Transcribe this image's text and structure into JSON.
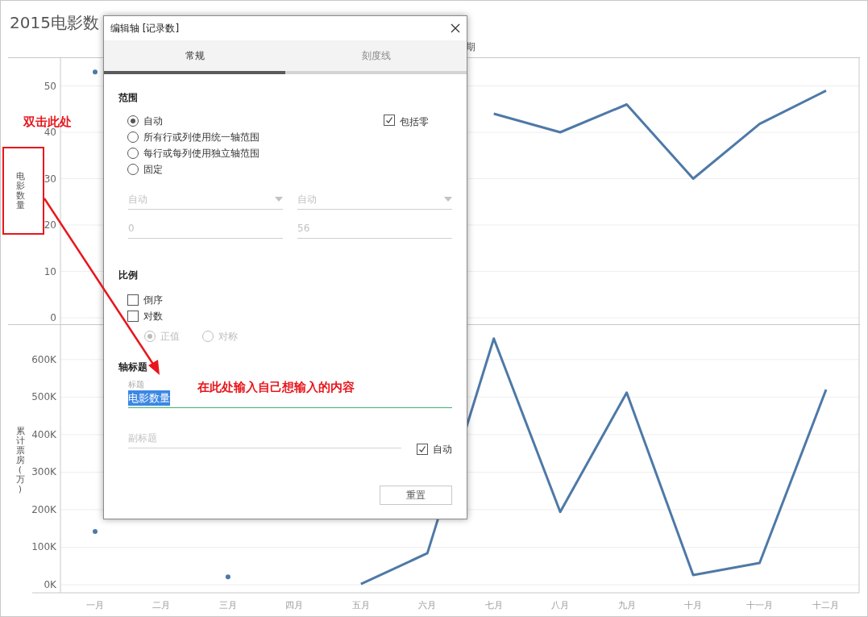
{
  "chart_title": "2015电影数",
  "column_header": "期",
  "panes": [
    {
      "chart_data": {
        "type": "line",
        "grid": true,
        "ylim": [
          0,
          56
        ],
        "yticks": [
          0,
          10,
          20,
          30,
          40,
          50
        ],
        "series": [
          {
            "name": "电影数量",
            "color": "#4e79a7",
            "values": [
              53,
              null,
              null,
              null,
              null,
              null,
              44,
              40,
              46,
              30,
              41.8,
              49
            ]
          }
        ]
      }
    },
    {
      "chart_data": {
        "type": "line",
        "grid": true,
        "categories": [
          "一月",
          "二月",
          "三月",
          "四月",
          "五月",
          "六月",
          "七月",
          "八月",
          "九月",
          "十月",
          "十一月",
          "十二月"
        ],
        "ylim": [
          0,
          692000
        ],
        "yticks": [
          {
            "value": 0,
            "label": "0K"
          },
          {
            "value": 100000,
            "label": "100K"
          },
          {
            "value": 200000,
            "label": "200K"
          },
          {
            "value": 300000,
            "label": "300K"
          },
          {
            "value": 400000,
            "label": "400K"
          },
          {
            "value": 500000,
            "label": "500K"
          },
          {
            "value": 600000,
            "label": "600K"
          }
        ],
        "series": [
          {
            "name": "累计票房(万)",
            "color": "#4e79a7",
            "values": [
              142000,
              null,
              21000,
              null,
              2000,
              84000,
              656000,
              194000,
              512000,
              26000,
              58000,
              520000
            ]
          }
        ]
      }
    }
  ],
  "dialog": {
    "title": "编辑轴 [记录数]",
    "tabs": [
      {
        "label": "常规",
        "selected": true
      },
      {
        "label": "刻度线",
        "selected": false
      }
    ],
    "range": {
      "heading": "范围",
      "options": [
        {
          "label": "自动",
          "selected": true
        },
        {
          "label": "所有行或列使用统一轴范围",
          "selected": false
        },
        {
          "label": "每行或每列使用独立轴范围",
          "selected": false
        },
        {
          "label": "固定",
          "selected": false
        }
      ],
      "include_zero": {
        "label": "包括零",
        "checked": true
      },
      "selects": [
        {
          "value": "自动",
          "disabled": true
        },
        {
          "value": "自动",
          "disabled": true
        }
      ],
      "inputs": [
        {
          "value": "0",
          "disabled": true
        },
        {
          "value": "56",
          "disabled": true
        }
      ]
    },
    "scale": {
      "heading": "比例",
      "checks": [
        {
          "label": "倒序",
          "checked": false
        },
        {
          "label": "对数",
          "checked": false
        }
      ],
      "log_options": [
        {
          "label": "正值",
          "selected": true,
          "disabled": true
        },
        {
          "label": "对称",
          "selected": false,
          "disabled": true
        }
      ]
    },
    "axis_title": {
      "heading": "轴标题",
      "title_label": "标题",
      "title_value": "电影数量",
      "title_text_selected": true,
      "subtitle_placeholder": "副标题",
      "auto": {
        "label": "自动",
        "checked": true
      }
    },
    "reset_button": "重置"
  },
  "annotations": {
    "hint": "双击此处",
    "instruction": "在此处输入自己想输入的内容"
  }
}
